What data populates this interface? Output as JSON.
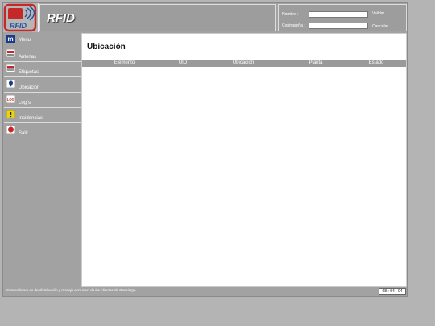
{
  "header": {
    "logo_text": "RFID",
    "title": "RFID"
  },
  "login": {
    "name_label": "Nombre :",
    "password_label": "Contraseña :",
    "validate_label": "Validar",
    "cancel_label": "Cancelar",
    "name_value": "",
    "password_value": ""
  },
  "sidebar": {
    "items": [
      {
        "label": "Menu",
        "icon": "menu-icon"
      },
      {
        "label": "Antenas",
        "icon": "antenna-icon"
      },
      {
        "label": "Etiquetas",
        "icon": "tag-icon"
      },
      {
        "label": "Ubicación",
        "icon": "location-icon"
      },
      {
        "label": "Log´s",
        "icon": "log-icon"
      },
      {
        "label": "Incidencias",
        "icon": "warning-icon"
      },
      {
        "label": "Salir",
        "icon": "exit-icon"
      }
    ]
  },
  "main": {
    "title": "Ubicación",
    "columns": [
      "Elemento",
      "UID",
      "Ubicacion",
      "Planta",
      "Estado"
    ]
  },
  "footer": {
    "text": "Este software es de distribución y manejo exclusivo de los clientes de Redsintge",
    "clock": "08 : 04 : 04"
  },
  "colors": {
    "accent": "#c62828",
    "frame": "#a2a2a2",
    "header_row": "#9a9a9a"
  }
}
